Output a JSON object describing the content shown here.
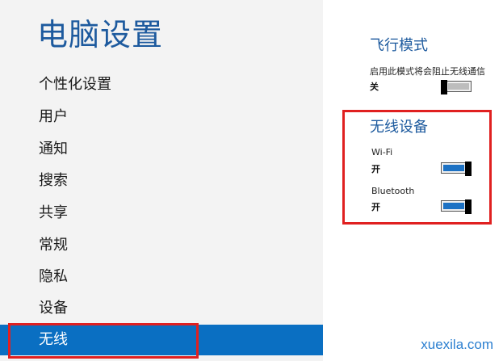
{
  "settings": {
    "title": "电脑设置",
    "nav": [
      {
        "label": "个性化设置"
      },
      {
        "label": "用户"
      },
      {
        "label": "通知"
      },
      {
        "label": "搜索"
      },
      {
        "label": "共享"
      },
      {
        "label": "常规"
      },
      {
        "label": "隐私"
      },
      {
        "label": "设备"
      },
      {
        "label": "无线",
        "selected": true
      }
    ]
  },
  "airplane": {
    "title": "飞行模式",
    "description": "启用此模式将会阻止无线通信",
    "state": "关"
  },
  "wireless": {
    "title": "无线设备",
    "wifi": {
      "label": "Wi-Fi",
      "state": "开"
    },
    "bluetooth": {
      "label": "Bluetooth",
      "state": "开"
    }
  },
  "watermark": "xuexila.com",
  "colors": {
    "accent": "#0a6fc2",
    "title": "#1d5a9e",
    "highlight": "#e02020"
  }
}
